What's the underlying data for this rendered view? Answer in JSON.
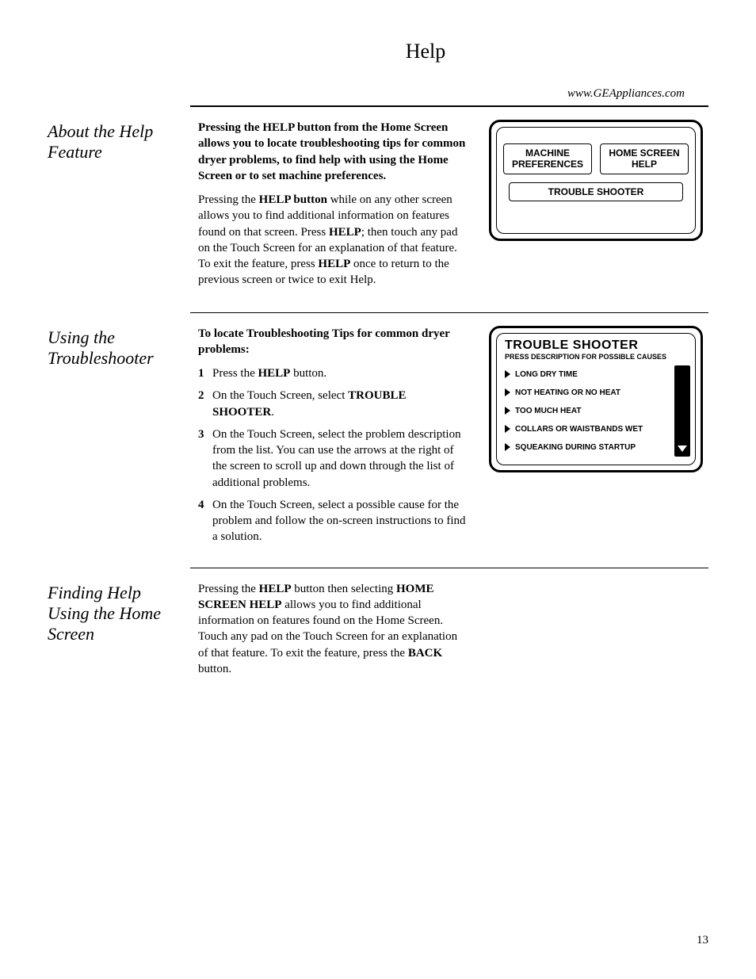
{
  "header": {
    "title": "Help",
    "url": "www.GEAppliances.com"
  },
  "section1": {
    "heading": "About the Help Feature",
    "p1_part1": "Pressing the HELP button from the Home Screen allows you to locate troubleshooting tips for common dryer problems, to find help with using the Home Screen or to set machine preferences.",
    "p2_a": "Pressing the ",
    "p2_b": "HELP button",
    "p2_c": " while on any other screen allows you to find additional information on features found on that screen. Press ",
    "p2_d": "HELP",
    "p2_e": "; then touch any pad on the Touch Screen for an explanation of that feature. To exit the feature, press ",
    "p2_f": "HELP",
    "p2_g": " once to return to the previous screen or twice to exit Help."
  },
  "panel1": {
    "btn1": "MACHINE PREFERENCES",
    "btn2": "HOME SCREEN HELP",
    "btn3": "TROUBLE SHOOTER"
  },
  "section2": {
    "heading": "Using the Troubleshooter",
    "lead": "To locate Troubleshooting Tips for common dryer problems:",
    "li1_a": "Press the ",
    "li1_b": "HELP",
    "li1_c": " button.",
    "li2_a": "On the Touch Screen, select ",
    "li2_b": "TROUBLE SHOOTER",
    "li2_c": ".",
    "li3": "On the Touch Screen, select the problem description from the list. You can use the arrows at the right of the screen to scroll up and down through the list of additional problems.",
    "li4": "On the Touch Screen, select a possible cause for the problem and follow the on-screen instructions to find a solution."
  },
  "panel2": {
    "title": "TROUBLE SHOOTER",
    "sub": "PRESS DESCRIPTION FOR POSSIBLE CAUSES",
    "items": {
      "0": "LONG DRY TIME",
      "1": "NOT HEATING OR NO HEAT",
      "2": "TOO MUCH HEAT",
      "3": "COLLARS OR WAISTBANDS WET",
      "4": "SQUEAKING DURING STARTUP"
    }
  },
  "section3": {
    "heading": "Finding Help Using the Home Screen",
    "p_a": "Pressing the ",
    "p_b": "HELP",
    "p_c": " button then selecting ",
    "p_d": "HOME SCREEN HELP",
    "p_e": " allows you to find additional information on features found on the Home Screen. Touch any pad on the Touch Screen for an explanation of that feature. To exit the feature, press the ",
    "p_f": "BACK",
    "p_g": " button."
  },
  "page_number": "13"
}
